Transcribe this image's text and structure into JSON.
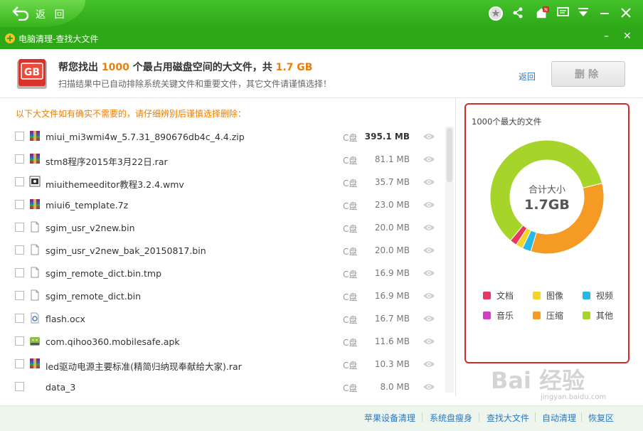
{
  "topbar": {
    "back_label": "返 回"
  },
  "window": {
    "title": "电脑清理-查找大文件",
    "minimize": "–",
    "close": "✕"
  },
  "header": {
    "line1_pre": "帮您找出 ",
    "count": "1000",
    "line1_mid": " 个最占用磁盘空间的大文件，共 ",
    "total": "1.7 GB",
    "line2": "扫描结果中已自动排除系统关键文件和重要文件，其它文件请谨慎选择！",
    "back_link": "返回",
    "delete_label": "删除"
  },
  "note": "以下大文件如有确实不需要的，请仔细辨别后谨慎选择删除：",
  "files": [
    {
      "name": "miui_mi3wmi4w_5.7.31_890676db4c_4.4.zip",
      "drive": "C盘",
      "size": "395.1 MB",
      "icon": "archive-icon",
      "bold": true
    },
    {
      "name": "stm8程序2015年3月22日.rar",
      "drive": "C盘",
      "size": "81.1 MB",
      "icon": "archive-icon"
    },
    {
      "name": "miuithemeeditor教程3.2.4.wmv",
      "drive": "C盘",
      "size": "35.7 MB",
      "icon": "video-icon"
    },
    {
      "name": "miui6_template.7z",
      "drive": "C盘",
      "size": "23.0 MB",
      "icon": "archive-icon"
    },
    {
      "name": "sgim_usr_v2new.bin",
      "drive": "C盘",
      "size": "20.0 MB",
      "icon": "file-icon"
    },
    {
      "name": "sgim_usr_v2new_bak_20150817.bin",
      "drive": "C盘",
      "size": "20.0 MB",
      "icon": "file-icon"
    },
    {
      "name": "sgim_remote_dict.bin.tmp",
      "drive": "C盘",
      "size": "16.9 MB",
      "icon": "file-icon"
    },
    {
      "name": "sgim_remote_dict.bin",
      "drive": "C盘",
      "size": "16.9 MB",
      "icon": "file-icon"
    },
    {
      "name": "flash.ocx",
      "drive": "C盘",
      "size": "16.7 MB",
      "icon": "gear-file-icon"
    },
    {
      "name": "com.qihoo360.mobilesafe.apk",
      "drive": "C盘",
      "size": "11.6 MB",
      "icon": "android-icon"
    },
    {
      "name": "led驱动电源主要标准(精简归纳现奉献给大家).rar",
      "drive": "C盘",
      "size": "10.3 MB",
      "icon": "archive-icon"
    },
    {
      "name": "data_3",
      "drive": "C盘",
      "size": "8.0 MB",
      "icon": "blank-icon"
    }
  ],
  "panel": {
    "title": "1000个最大的文件",
    "total_label": "合计大小",
    "total_value": "1.7GB",
    "legend": [
      {
        "label": "文档",
        "color": "#e8395c"
      },
      {
        "label": "图像",
        "color": "#f5d328"
      },
      {
        "label": "视频",
        "color": "#27b8e8"
      },
      {
        "label": "音乐",
        "color": "#d23dc6"
      },
      {
        "label": "压缩",
        "color": "#f59a23"
      },
      {
        "label": "其他",
        "color": "#a6d42a"
      }
    ],
    "shares": [
      {
        "label": "其他",
        "fraction": 0.6,
        "color": "#a6d42a"
      },
      {
        "label": "压缩",
        "fraction": 0.335,
        "color": "#f59a23"
      },
      {
        "label": "视频",
        "fraction": 0.025,
        "color": "#27b8e8"
      },
      {
        "label": "图像",
        "fraction": 0.02,
        "color": "#f5d328"
      },
      {
        "label": "文档",
        "fraction": 0.02,
        "color": "#e8395c"
      }
    ]
  },
  "footer": {
    "links": [
      "苹果设备清理",
      "系统盘瘦身",
      "查找大文件",
      "自动清理",
      "恢复区"
    ]
  },
  "watermark": {
    "text": "Bai 经验",
    "sub": "jingyan.baidu.com"
  }
}
